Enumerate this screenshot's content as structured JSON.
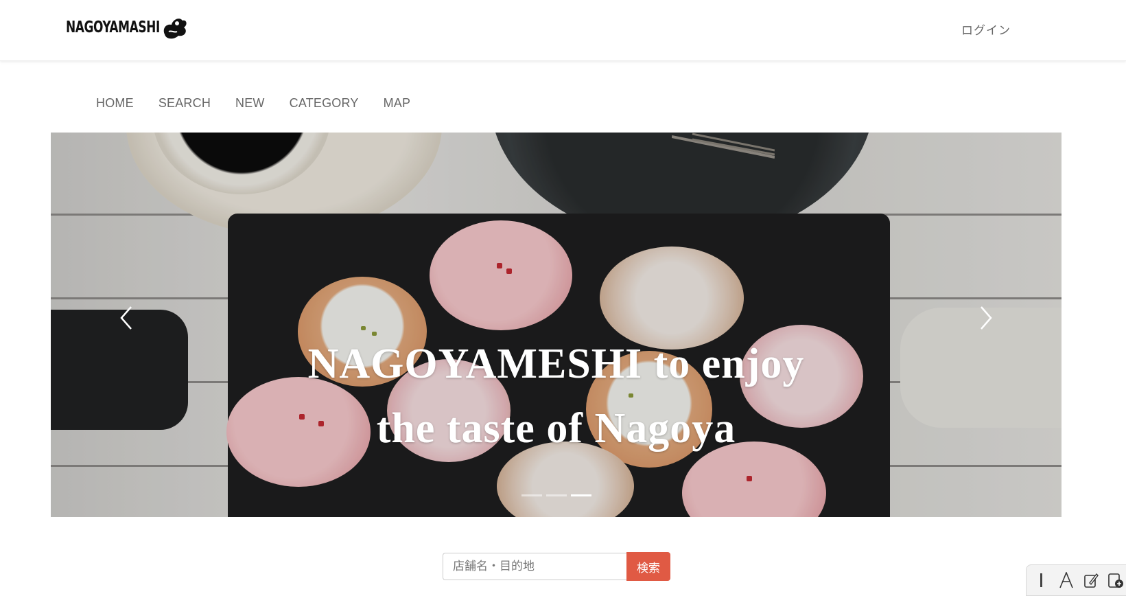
{
  "header": {
    "logo_text": "NAGOYAMASHI",
    "login_label": "ログイン"
  },
  "nav": {
    "items": [
      {
        "label": "HOME"
      },
      {
        "label": "SEARCH"
      },
      {
        "label": "NEW"
      },
      {
        "label": "CATEGORY"
      },
      {
        "label": "MAP"
      }
    ]
  },
  "hero": {
    "caption_line1": "NAGOYAMESHI to enjoy",
    "caption_line2": "the taste of Nagoya",
    "active_slide": 3,
    "slide_count": 3
  },
  "search": {
    "placeholder": "店舗名・目的地",
    "value": "",
    "button_label": "検索"
  },
  "tools": [
    "ruler-icon",
    "text-icon",
    "edit-icon",
    "new-document-icon"
  ],
  "colors": {
    "accent": "#e05a44",
    "text": "#666666"
  }
}
